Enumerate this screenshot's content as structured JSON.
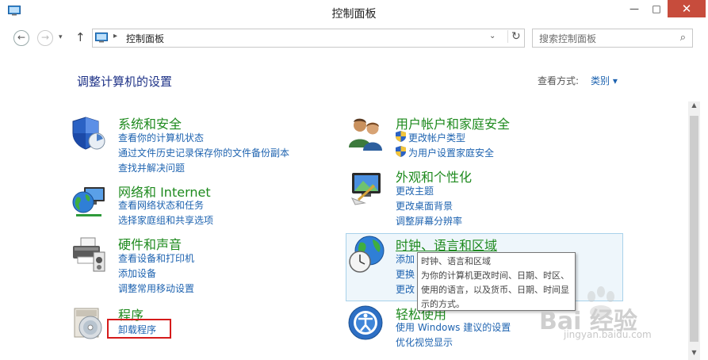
{
  "window": {
    "title": "控制面板",
    "minimize": "—",
    "maximize": "□",
    "close": "✕"
  },
  "nav": {
    "back": "←",
    "forward": "→",
    "history": "▾",
    "up": "↑",
    "address": {
      "separator": "▸",
      "path": "控制面板",
      "dropdown": "⌄",
      "refresh": "↻"
    },
    "search": {
      "placeholder": "搜索控制面板"
    }
  },
  "page": {
    "title": "调整计算机的设置",
    "view_label": "查看方式:",
    "view_value": "类别 ▾"
  },
  "categories": [
    {
      "title": "系统和安全",
      "icon": "shield-icon",
      "links": [
        "查看你的计算机状态",
        "通过文件历史记录保存你的文件备份副本",
        "查找并解决问题"
      ]
    },
    {
      "title": "网络和 Internet",
      "icon": "network-globe-icon",
      "links": [
        "查看网络状态和任务",
        "选择家庭组和共享选项"
      ]
    },
    {
      "title": "硬件和声音",
      "icon": "printer-icon",
      "links": [
        "查看设备和打印机",
        "添加设备",
        "调整常用移动设置"
      ]
    },
    {
      "title": "程序",
      "icon": "programs-disc-icon",
      "links": [
        "卸载程序"
      ]
    },
    {
      "title": "用户帐户和家庭安全",
      "icon": "users-icon",
      "links": [
        "更改帐户类型",
        "为用户设置家庭安全"
      ]
    },
    {
      "title": "外观和个性化",
      "icon": "monitor-paint-icon",
      "links": [
        "更改主题",
        "更改桌面背景",
        "调整屏幕分辨率"
      ]
    },
    {
      "title": "时钟、语言和区域",
      "icon": "clock-globe-icon",
      "links": [
        "添加",
        "更换",
        "更改"
      ]
    },
    {
      "title": "轻松使用",
      "icon": "ease-of-access-icon",
      "links": [
        "使用 Windows 建议的设置",
        "优化视觉显示"
      ]
    }
  ],
  "tooltip": {
    "title": "时钟、语言和区域",
    "body": "为你的计算机更改时间、日期、时区、使用的语言，以及货币、日期、时间显示的方式。"
  },
  "scrollbar": {
    "up": "▲",
    "down": "▼"
  },
  "watermark": {
    "logo": "Bai 经验",
    "sub": "jingyan.baidu.com"
  },
  "colors": {
    "accent_blue": "#1e63b0",
    "category_green": "#1e8a1e",
    "annotation_red": "#d51b1b",
    "close_red": "#c74c3c"
  }
}
